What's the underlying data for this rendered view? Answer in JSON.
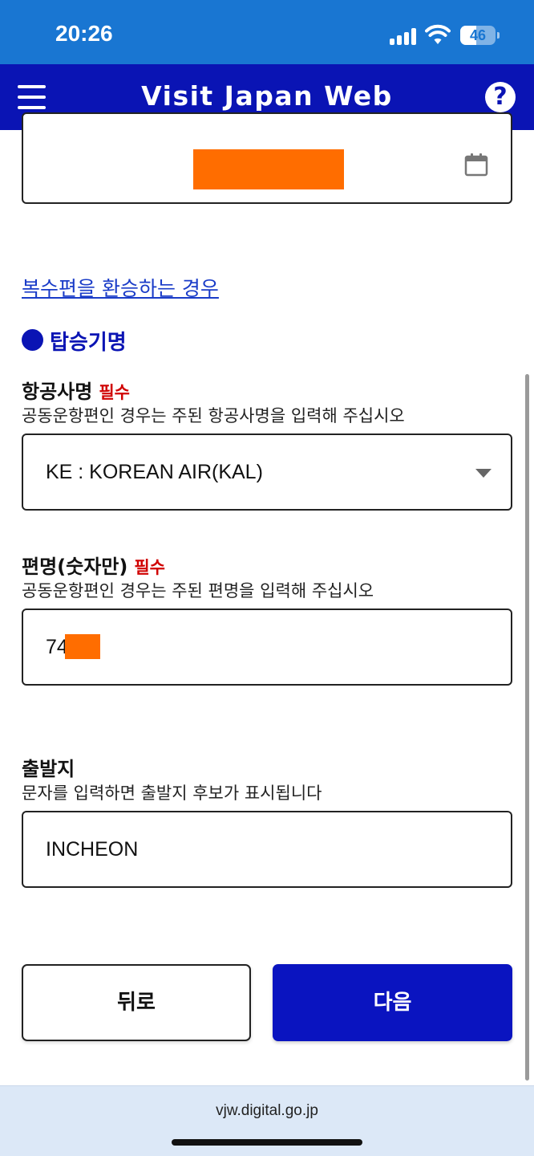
{
  "status_bar": {
    "time": "20:26",
    "battery": "46",
    "battery_level": 0.46
  },
  "header": {
    "title": "Visit Japan Web",
    "help_glyph": "?"
  },
  "transfer_link": "복수편을 환승하는 경우",
  "section": {
    "title": "탑승기명"
  },
  "airline": {
    "label": "항공사명",
    "required": "필수",
    "hint": "공동운항편인 경우는 주된 항공사명을 입력해 주십시오",
    "value": "KE : KOREAN AIR(KAL)"
  },
  "flight": {
    "label": "편명(숫자만)",
    "required": "필수",
    "hint": "공동운항편인 경우는 주된 편명을 입력해 주십시오",
    "value": "74"
  },
  "departure": {
    "label": "출발지",
    "hint": "문자를 입력하면 출발지 후보가 표시됩니다",
    "value": "INCHEON"
  },
  "buttons": {
    "back": "뒤로",
    "next": "다음"
  },
  "url": "vjw.digital.go.jp",
  "colors": {
    "header": "#0a14b4",
    "status_bar": "#1976d2",
    "required": "#d00000",
    "link": "#1a3cc8",
    "redaction": "#ff6d00"
  },
  "icons": {
    "menu": "menu-icon",
    "help": "help-icon",
    "calendar": "calendar-icon",
    "dropdown": "chevron-down-icon"
  }
}
